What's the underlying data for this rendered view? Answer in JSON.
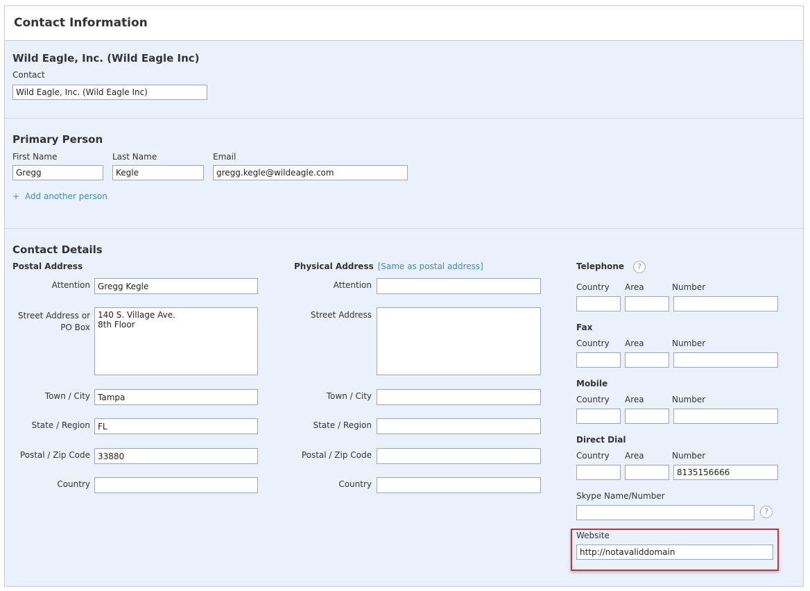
{
  "panel": {
    "title": "Contact Information"
  },
  "contact": {
    "heading": "Wild Eagle, Inc. (Wild Eagle Inc)",
    "label": "Contact",
    "value": "Wild Eagle, Inc. (Wild Eagle Inc)"
  },
  "primary_person": {
    "heading": "Primary Person",
    "first_name_label": "First Name",
    "first_name_value": "Gregg",
    "last_name_label": "Last Name",
    "last_name_value": "Kegle",
    "email_label": "Email",
    "email_value": "gregg.kegle@wildeagle.com",
    "add_icon": "+",
    "add_person_link": "Add another person"
  },
  "contact_details": {
    "heading": "Contact Details",
    "postal": {
      "heading": "Postal Address",
      "attention_label": "Attention",
      "attention_value": "Gregg Kegle",
      "street_label_line1": "Street Address or",
      "street_label_line2": "PO Box",
      "street_value": "140 S. Village Ave.\n8th Floor",
      "city_label": "Town / City",
      "city_value": "Tampa",
      "state_label": "State / Region",
      "state_value": "FL",
      "zip_label": "Postal / Zip Code",
      "zip_value": "33880",
      "country_label": "Country",
      "country_value": ""
    },
    "physical": {
      "heading": "Physical Address",
      "same_as_link": "[Same as postal address]",
      "attention_label": "Attention",
      "attention_value": "",
      "street_label": "Street Address",
      "street_value": "",
      "city_label": "Town / City",
      "city_value": "",
      "state_label": "State / Region",
      "state_value": "",
      "zip_label": "Postal / Zip Code",
      "zip_value": "",
      "country_label": "Country",
      "country_value": ""
    },
    "phones": {
      "country_label": "Country",
      "area_label": "Area",
      "number_label": "Number",
      "help_icon": "?",
      "telephone": {
        "heading": "Telephone",
        "country": "",
        "area": "",
        "number": ""
      },
      "fax": {
        "heading": "Fax",
        "country": "",
        "area": "",
        "number": ""
      },
      "mobile": {
        "heading": "Mobile",
        "country": "",
        "area": "",
        "number": ""
      },
      "direct_dial": {
        "heading": "Direct Dial",
        "country": "",
        "area": "",
        "number": "8135156666"
      }
    },
    "skype": {
      "label": "Skype Name/Number",
      "value": ""
    },
    "website": {
      "label": "Website",
      "value": "http://notavaliddomain"
    }
  },
  "colors": {
    "panel_bg": "#eaf1fb",
    "link": "#3a8fc6",
    "highlight_border": "#b43a3a"
  }
}
